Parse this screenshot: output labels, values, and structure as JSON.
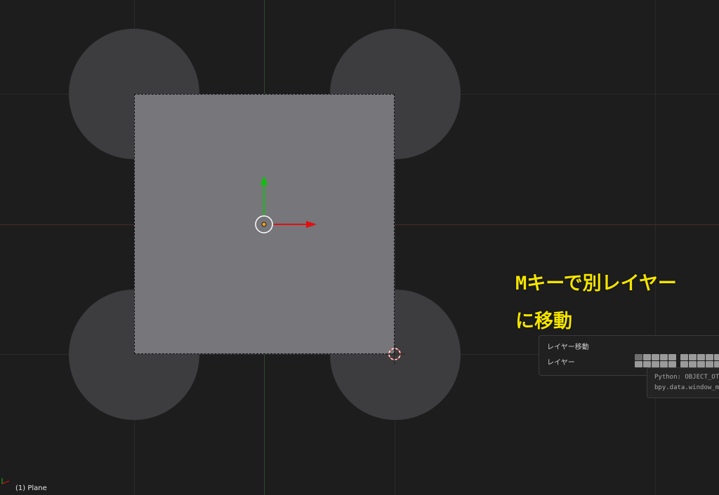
{
  "annotation": {
    "line1": "Mキーで別レイヤー",
    "line2": "に移動",
    "color": "#f5e500"
  },
  "operator_panel": {
    "title": "レイヤー移動",
    "layer_label": "レイヤー"
  },
  "tooltip": {
    "line1": "Python: OBJECT_OT_",
    "line2": "bpy.data.window_ma"
  },
  "status": {
    "object_label": "(1) Plane"
  },
  "viewport": {
    "background": "#1d1d1d",
    "plane_color": "#76767b",
    "circle_color": "#3d3d3f",
    "gizmo_x_color": "#e01010",
    "gizmo_y_color": "#10c010"
  },
  "icons": [
    "origin-icon",
    "x-arrow-icon",
    "y-arrow-icon",
    "3d-cursor-icon",
    "axis-indicator-icon"
  ]
}
